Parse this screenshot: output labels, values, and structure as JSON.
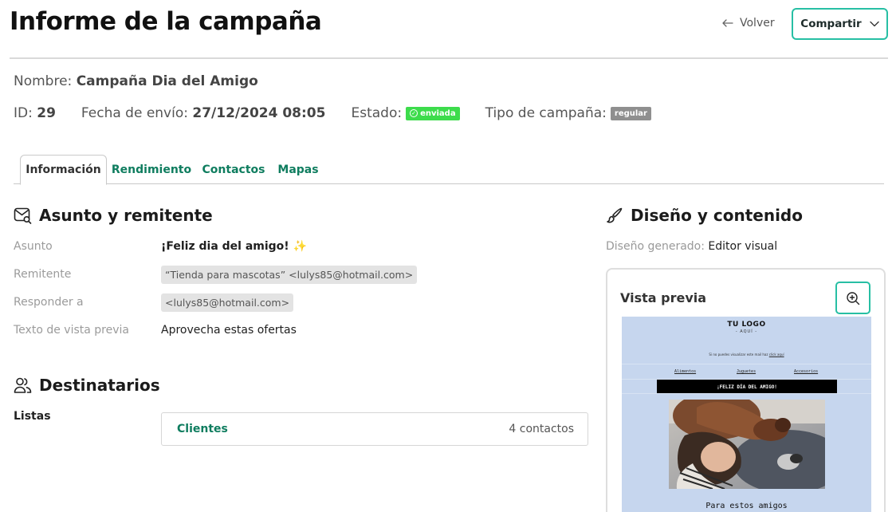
{
  "header": {
    "title": "Informe de la campaña",
    "back_label": "Volver",
    "share_label": "Compartir"
  },
  "campaign": {
    "name_label": "Nombre:",
    "name": "Campaña Dia del Amigo",
    "id_label": "ID:",
    "id": "29",
    "date_label": "Fecha de envío:",
    "date": "27/12/2024 08:05",
    "status_label": "Estado:",
    "status": "enviada",
    "type_label": "Tipo de campaña:",
    "type": "regular"
  },
  "tabs": [
    {
      "label": "Información",
      "active": true
    },
    {
      "label": "Rendimiento",
      "active": false
    },
    {
      "label": "Contactos",
      "active": false
    },
    {
      "label": "Mapas",
      "active": false
    }
  ],
  "subject_section": {
    "title": "Asunto y remitente",
    "fields": [
      {
        "label": "Asunto",
        "value": "¡Feliz dia del amigo! ✨"
      },
      {
        "label": "Remitente",
        "value": "“Tienda para mascotas” <lulys85@hotmail.com>"
      },
      {
        "label": "Responder a",
        "value": "<lulys85@hotmail.com>"
      },
      {
        "label": "Texto de vista previa",
        "value": "Aprovecha estas ofertas"
      }
    ]
  },
  "recipients_section": {
    "title": "Destinatarios",
    "lists_label": "Listas",
    "lists": [
      {
        "name": "Clientes",
        "count": "4 contactos"
      }
    ]
  },
  "design_section": {
    "title": "Diseño y contenido",
    "generated_label": "Diseño generado:",
    "generated_value": "Editor visual",
    "preview_title": "Vista previa",
    "email": {
      "logo": "TU LOGO",
      "logo_sub": "- AQUÍ -",
      "notice": "Si no puedes visualizar este mail haz",
      "notice_link": "click aquí",
      "nav": [
        "Alimentos",
        "Juguetes",
        "Accesorios"
      ],
      "banner": "¡FELIZ DÍA DEL AMIGO!",
      "footer_text": "Para estos amigos"
    }
  },
  "colors": {
    "accent": "#27bfa4",
    "link_green": "#0f7d5f",
    "status_sent": "#3ddc4c",
    "email_bg": "#c6d6ee"
  }
}
